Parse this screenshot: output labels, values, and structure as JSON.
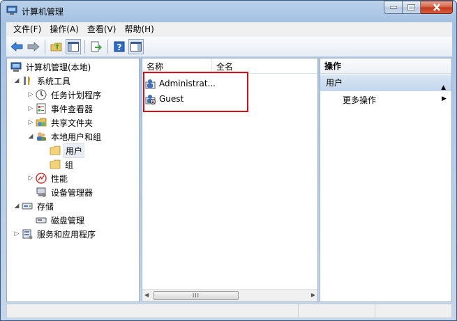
{
  "window": {
    "title": "计算机管理"
  },
  "menu": [
    "文件(F)",
    "操作(A)",
    "查看(V)",
    "帮助(H)"
  ],
  "tree": {
    "root": "计算机管理(本地)",
    "system_tools": "系统工具",
    "task_scheduler": "任务计划程序",
    "event_viewer": "事件查看器",
    "shared_folders": "共享文件夹",
    "local_users_groups": "本地用户和组",
    "users": "用户",
    "groups": "组",
    "performance": "性能",
    "device_manager": "设备管理器",
    "storage": "存储",
    "disk_management": "磁盘管理",
    "services_apps": "服务和应用程序"
  },
  "list": {
    "columns": [
      "名称",
      "全名"
    ],
    "rows": [
      {
        "name": "Administrat...",
        "fullname": ""
      },
      {
        "name": "Guest",
        "fullname": ""
      }
    ],
    "scroll_thumb": "III"
  },
  "actions": {
    "header": "操作",
    "section": "用户",
    "more": "更多操作"
  },
  "colors": {
    "highlight_box": "#d0121c",
    "selection_bg": "#c3d6ec",
    "titlebar": "#b9d1ea"
  }
}
